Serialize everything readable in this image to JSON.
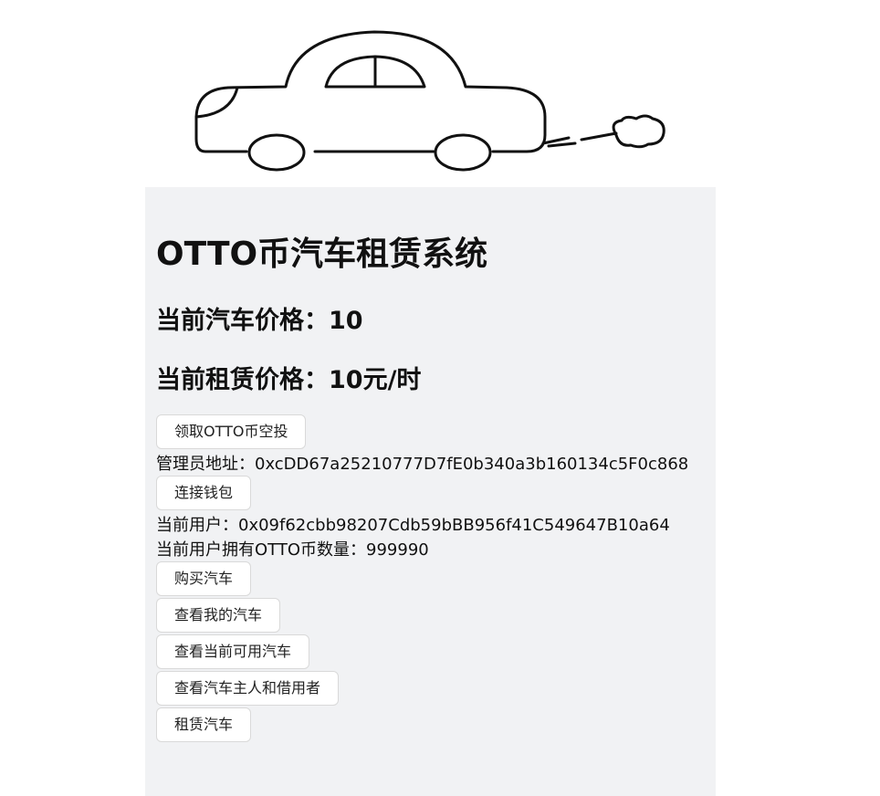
{
  "app": {
    "title": "OTTO币汽车租赁系统",
    "car_price_label": "当前汽车价格：",
    "car_price_value": "10",
    "rent_price_label": "当前租赁价格：",
    "rent_price_value": "10元/时"
  },
  "buttons": {
    "airdrop": "领取OTTO币空投",
    "connect_wallet": "连接钱包",
    "buy_car": "购买汽车",
    "view_my_cars": "查看我的汽车",
    "view_available_cars": "查看当前可用汽车",
    "view_owner_borrower": "查看汽车主人和借用者",
    "rent_car": "租赁汽车"
  },
  "info": {
    "admin_label": "管理员地址：",
    "admin_address": "0xcDD67a25210777D7fE0b340a3b160134c5F0c868",
    "user_label": "当前用户：",
    "user_address": "0x09f62cbb98207Cdb59bBB956f41C549647B10a64",
    "balance_label": "当前用户拥有OTTO币数量：",
    "balance_value": "999990"
  },
  "icons": {
    "banner": "car-illustration"
  }
}
